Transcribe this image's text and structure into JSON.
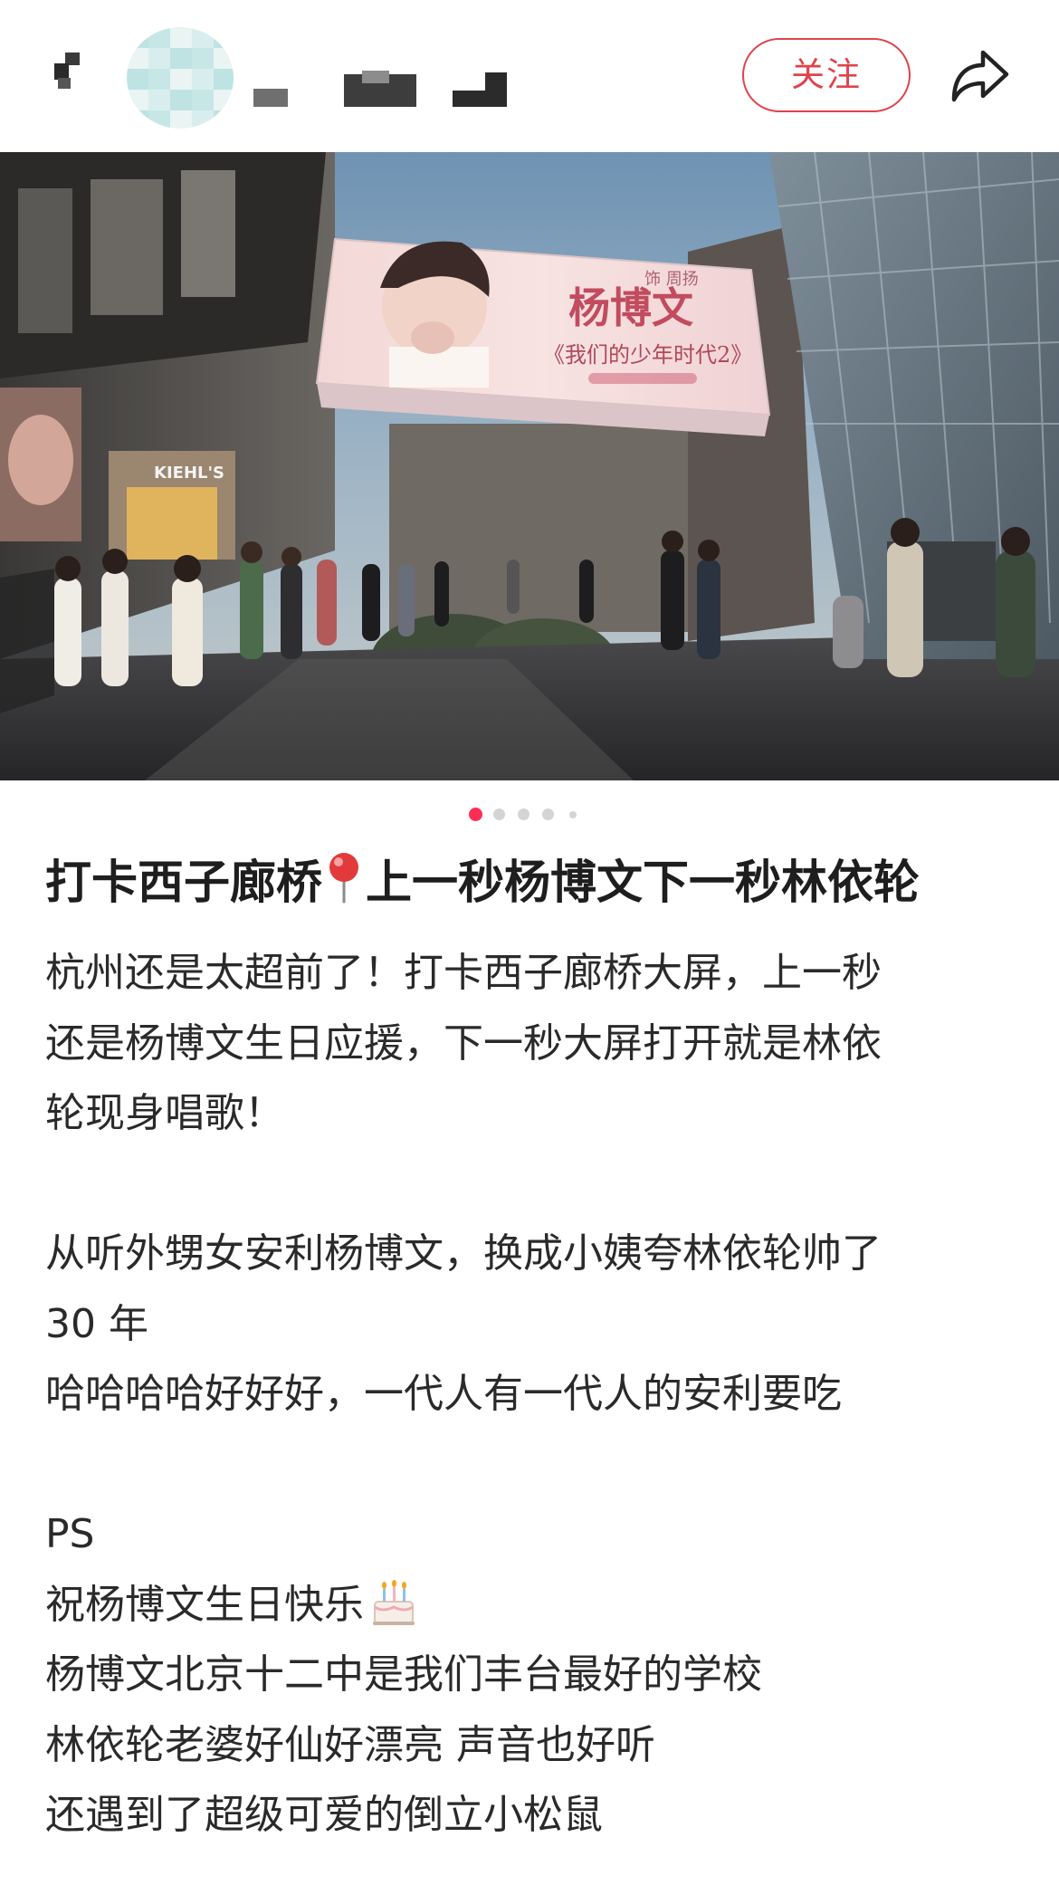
{
  "header": {
    "follow_label": "关注",
    "icons": [
      "back-icon",
      "avatar",
      "share-icon"
    ]
  },
  "gallery": {
    "image_count": 5,
    "active_index": 0,
    "billboard": {
      "name": "杨博文",
      "show": "《我们的少年时代2》",
      "role": "饰 周扬",
      "store_sign": "KIEHL'S"
    }
  },
  "post": {
    "title": "打卡西子廊桥",
    "title_pin": "round-pushpin-icon",
    "title_rest": "上一秒杨博文下一秒林依轮",
    "lines": [
      "杭州还是太超前了！打卡西子廊桥大屏，上一秒",
      "还是杨博文生日应援，下一秒大屏打开就是林依",
      "轮现身唱歌！",
      "",
      "从听外甥女安利杨博文，换成小姨夸林依轮帅了",
      " 30 年",
      "哈哈哈哈好好好，一代人有一代人的安利要吃",
      "",
      "PS",
      "祝杨博文生日快乐",
      "杨博文北京十二中是我们丰台最好的学校",
      "林依轮老婆好仙好漂亮 声音也好听",
      "还遇到了超级可爱的倒立小松鼠"
    ],
    "birthday_emoji": "birthday-cake-icon"
  },
  "colors": {
    "accent": "#e0434b",
    "dot_active": "#ff2d55",
    "dot_inactive": "#d4d4d4",
    "text": "#2a2a2a"
  }
}
